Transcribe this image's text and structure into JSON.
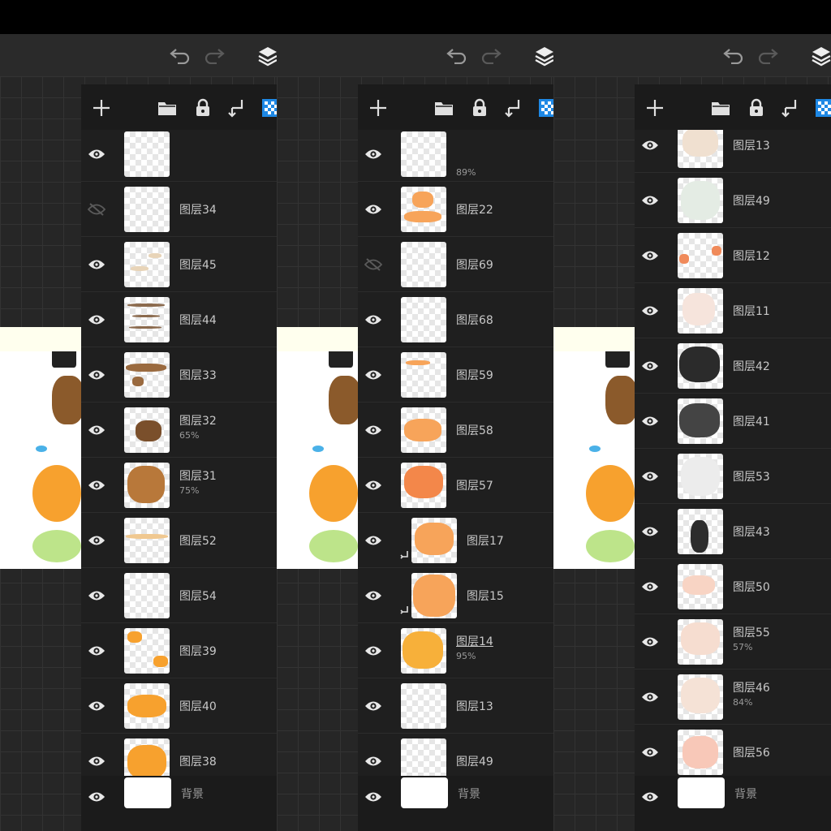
{
  "colors": {
    "accent": "#1e88e5",
    "orange": "#f7a12e",
    "brown": "#8b5a2b"
  },
  "panels": [
    {
      "layers": [
        {
          "name": "",
          "opacity": "",
          "visible": true,
          "partial": true,
          "art": []
        },
        {
          "name": "图层34",
          "opacity": "",
          "visible": false,
          "art": []
        },
        {
          "name": "图层45",
          "opacity": "",
          "visible": true,
          "art": [
            [
              "#e8d4b8",
              8,
              30,
              22,
              6
            ],
            [
              "#e8d4b8",
              30,
              14,
              16,
              6
            ]
          ]
        },
        {
          "name": "图层44",
          "opacity": "",
          "visible": true,
          "art": [
            [
              "#8b6a4d",
              4,
              8,
              46,
              4
            ],
            [
              "#8b6a4d",
              10,
              22,
              34,
              3
            ],
            [
              "#8b6a4d",
              6,
              36,
              40,
              3
            ]
          ]
        },
        {
          "name": "图层33",
          "opacity": "",
          "visible": true,
          "art": [
            [
              "#9a6a3f",
              2,
              14,
              50,
              10
            ],
            [
              "#9a6a3f",
              10,
              30,
              14,
              12
            ]
          ]
        },
        {
          "name": "图层32",
          "opacity": "65%",
          "visible": true,
          "art": [
            [
              "#7a4f2b",
              14,
              16,
              32,
              26
            ]
          ]
        },
        {
          "name": "图层31",
          "opacity": "75%",
          "visible": true,
          "art": [
            [
              "#b8783a",
              4,
              4,
              46,
              46
            ]
          ]
        },
        {
          "name": "图层52",
          "opacity": "",
          "visible": true,
          "art": [
            [
              "#f0c890",
              2,
              20,
              52,
              6
            ]
          ]
        },
        {
          "name": "图层54",
          "opacity": "",
          "visible": true,
          "art": []
        },
        {
          "name": "图层39",
          "opacity": "",
          "visible": true,
          "art": [
            [
              "#f7a12e",
              4,
              4,
              18,
              14
            ],
            [
              "#f7a12e",
              36,
              34,
              18,
              14
            ]
          ]
        },
        {
          "name": "图层40",
          "opacity": "",
          "visible": true,
          "art": [
            [
              "#f7a12e",
              4,
              14,
              48,
              28
            ]
          ]
        },
        {
          "name": "图层38",
          "opacity": "",
          "visible": true,
          "art": [
            [
              "#f7a12e",
              4,
              8,
              48,
              42
            ]
          ]
        },
        {
          "name": "",
          "opacity": "",
          "visible": true,
          "partial": true,
          "art": []
        }
      ]
    },
    {
      "layers": [
        {
          "name": "",
          "opacity": "89%",
          "visible": true,
          "partial": true,
          "art": []
        },
        {
          "name": "图层22",
          "opacity": "",
          "visible": true,
          "art": [
            [
              "#f7a45a",
              14,
              6,
              26,
              20
            ],
            [
              "#f7a45a",
              4,
              30,
              46,
              14
            ]
          ]
        },
        {
          "name": "图层69",
          "opacity": "",
          "visible": false,
          "art": []
        },
        {
          "name": "图层68",
          "opacity": "",
          "visible": true,
          "art": []
        },
        {
          "name": "图层59",
          "opacity": "",
          "visible": true,
          "art": [
            [
              "#f7a45a",
              6,
              10,
              30,
              6
            ]
          ]
        },
        {
          "name": "图层58",
          "opacity": "",
          "visible": true,
          "art": [
            [
              "#f7a45a",
              4,
              14,
              46,
              28
            ]
          ]
        },
        {
          "name": "图层57",
          "opacity": "",
          "visible": true,
          "art": [
            [
              "#f3874a",
              4,
              4,
              48,
              40
            ]
          ]
        },
        {
          "name": "图层17",
          "opacity": "",
          "visible": true,
          "clip": true,
          "art": [
            [
              "#f7a45a",
              4,
              6,
              48,
              40
            ]
          ]
        },
        {
          "name": "图层15",
          "opacity": "",
          "visible": true,
          "clip": true,
          "art": [
            [
              "#f7a45a",
              2,
              2,
              52,
              52
            ]
          ]
        },
        {
          "name": "图层14",
          "opacity": "95%",
          "visible": true,
          "underline": true,
          "art": [
            [
              "#f7b03a",
              2,
              4,
              50,
              46
            ]
          ]
        },
        {
          "name": "图层13",
          "opacity": "",
          "visible": true,
          "art": []
        },
        {
          "name": "图层49",
          "opacity": "",
          "visible": true,
          "art": []
        },
        {
          "name": "",
          "opacity": "",
          "visible": true,
          "partial": true,
          "art": []
        }
      ]
    },
    {
      "layers": [
        {
          "name": "图层13",
          "opacity": "",
          "visible": true,
          "art": [
            [
              "#f0e0d0",
              6,
              6,
              44,
              36
            ]
          ]
        },
        {
          "name": "图层49",
          "opacity": "",
          "visible": true,
          "art": [
            [
              "#e4ece4",
              4,
              4,
              48,
              48
            ]
          ]
        },
        {
          "name": "图层12",
          "opacity": "",
          "visible": true,
          "art": [
            [
              "#f08a5a",
              2,
              26,
              12,
              12
            ],
            [
              "#f08a5a",
              42,
              16,
              12,
              12
            ]
          ]
        },
        {
          "name": "图层11",
          "opacity": "",
          "visible": true,
          "art": [
            [
              "#f6e4dc",
              6,
              6,
              40,
              40
            ]
          ]
        },
        {
          "name": "图层42",
          "opacity": "",
          "visible": true,
          "art": [
            [
              "#2b2b2b",
              2,
              4,
              50,
              44
            ]
          ]
        },
        {
          "name": "图层41",
          "opacity": "",
          "visible": true,
          "art": [
            [
              "#444",
              2,
              6,
              50,
              42
            ]
          ]
        },
        {
          "name": "图层53",
          "opacity": "",
          "visible": true,
          "art": [
            [
              "#ececec",
              4,
              4,
              48,
              48
            ]
          ]
        },
        {
          "name": "图层43",
          "opacity": "",
          "visible": true,
          "art": [
            [
              "#2d2d2d",
              16,
              14,
              22,
              40
            ]
          ]
        },
        {
          "name": "图层50",
          "opacity": "",
          "visible": true,
          "art": [
            [
              "#f8d4c4",
              6,
              14,
              40,
              24
            ]
          ]
        },
        {
          "name": "图层55",
          "opacity": "57%",
          "visible": true,
          "art": [
            [
              "#f6ddd0",
              4,
              4,
              48,
              40
            ]
          ]
        },
        {
          "name": "图层46",
          "opacity": "84%",
          "visible": true,
          "art": [
            [
              "#f5e2d6",
              4,
              4,
              48,
              44
            ]
          ]
        },
        {
          "name": "图层56",
          "opacity": "",
          "visible": true,
          "partial": true,
          "art": [
            [
              "#f8c8b8",
              6,
              8,
              44,
              40
            ]
          ]
        }
      ]
    }
  ],
  "background_label": "背景"
}
